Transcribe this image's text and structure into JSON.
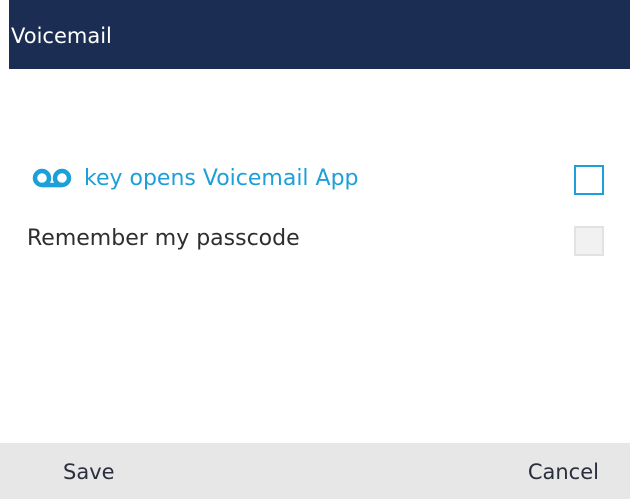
{
  "header": {
    "title": "Voicemail"
  },
  "settings": {
    "voicemail_key": {
      "icon": "voicemail-icon",
      "label": "key opens Voicemail App",
      "checked": false,
      "accent_color": "#1d9fd9"
    },
    "remember_passcode": {
      "label": "Remember my passcode",
      "checked": false,
      "enabled": false
    }
  },
  "softkeys": {
    "save_label": "Save",
    "cancel_label": "Cancel"
  },
  "colors": {
    "header_bg": "#1b2d52",
    "softkey_bar_bg": "#e7e7e7"
  }
}
